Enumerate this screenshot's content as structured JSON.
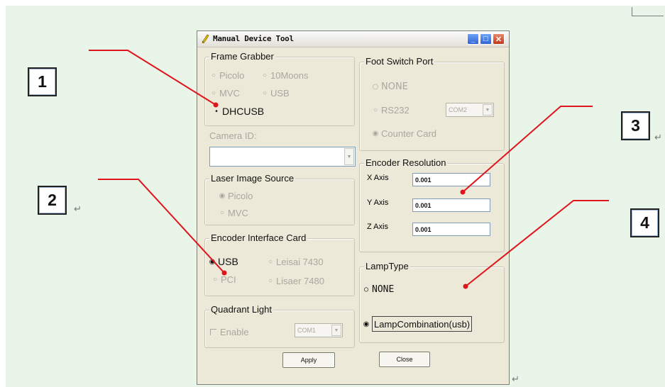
{
  "callouts": [
    "1",
    "2",
    "3",
    "4"
  ],
  "para_mark": "↵",
  "dialog": {
    "title": "Manual Device Tool",
    "icon": "pencil-icon",
    "frame_grabber": {
      "title": "Frame Grabber",
      "options": [
        "Picolo",
        "10Moons",
        "MVC",
        "USB",
        "DHCUSB"
      ],
      "selected": "DHCUSB"
    },
    "camera_id": {
      "label": "Camera ID:",
      "value": ""
    },
    "laser_image_source": {
      "title": "Laser Image  Source",
      "options": [
        "Picolo",
        "MVC"
      ],
      "selected": "Picolo"
    },
    "encoder_interface_card": {
      "title": "Encoder Interface Card",
      "options": [
        "USB",
        "Leisai 7430",
        "PCI",
        "Lisaer 7480"
      ],
      "selected": "USB"
    },
    "quadrant_light": {
      "title": "Quadrant Light",
      "enable_label": "Enable",
      "port": "COM1"
    },
    "foot_switch_port": {
      "title": "Foot Switch Port",
      "options": [
        "NONE",
        "RS232",
        "Counter Card"
      ],
      "port": "COM2",
      "selected": "Counter Card"
    },
    "encoder_resolution": {
      "title": "Encoder Resolution",
      "x_label": "X Axis",
      "x_value": "0.001",
      "y_label": "Y Axis",
      "y_value": "0.001",
      "z_label": "Z Axis",
      "z_value": "0.001"
    },
    "lamp_type": {
      "title": "LampType",
      "options": [
        "NONE",
        "LampCombination(usb)"
      ],
      "selected": "LampCombination(usb)"
    },
    "apply_label": "Apply",
    "close_label": "Close"
  },
  "colors": {
    "callout_line": "#e0141b",
    "dialog_bg": "#ece9d8",
    "page_bg": "#e9f5e9"
  }
}
